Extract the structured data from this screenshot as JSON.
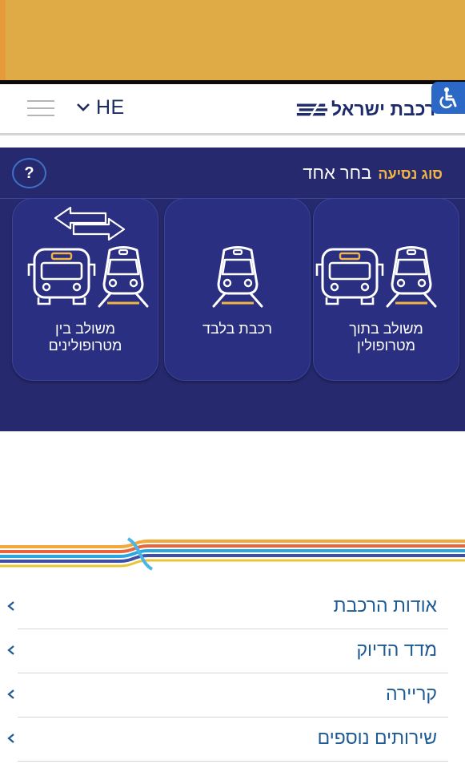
{
  "header": {
    "language": "HE",
    "logo_text": "רכבת ישראל",
    "icons": {
      "menu": "hamburger-menu-icon",
      "language": "chevron-down-icon",
      "accessibility": "wheelchair-icon",
      "logo": "israel-railways-logo-icon"
    }
  },
  "trip_type": {
    "title_accent": "סוג נסיעה",
    "title_main": "בחר אחד",
    "help_label": "?",
    "cards": [
      {
        "label": "משולב בתוך מטרופולין",
        "icons": [
          "bus-icon",
          "train-icon"
        ]
      },
      {
        "label": "רכבת בלבד",
        "icons": [
          "train-icon"
        ]
      },
      {
        "label": "משולב בין מטרופולינים",
        "icons": [
          "bidirectional-arrows-icon",
          "bus-icon",
          "train-icon"
        ]
      }
    ]
  },
  "menu": {
    "items": [
      {
        "label": "אודות הרכבת"
      },
      {
        "label": "מדד הדיוק"
      },
      {
        "label": "קריירה"
      },
      {
        "label": "שירותים נוספים"
      }
    ]
  },
  "colors": {
    "banner": "#dfab47",
    "panel": "#27296e",
    "card": "#2a2f82",
    "accent": "#f0b545",
    "link": "#1e5a93",
    "accessibility": "#2c69c6"
  }
}
